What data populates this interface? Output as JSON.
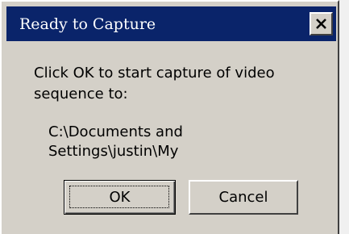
{
  "window": {
    "title": "Ready to Capture",
    "close_icon": "close-x-icon"
  },
  "body": {
    "message_line1": "Click OK to start capture of video",
    "message_line2": "sequence to:",
    "path_line1": "C:\\Documents and",
    "path_line2": "Settings\\justin\\My"
  },
  "buttons": {
    "ok_label": "OK",
    "cancel_label": "Cancel"
  },
  "colors": {
    "titlebar": "#0a246a",
    "dialog_face": "#d4d0c8",
    "title_text": "#ffffff"
  }
}
